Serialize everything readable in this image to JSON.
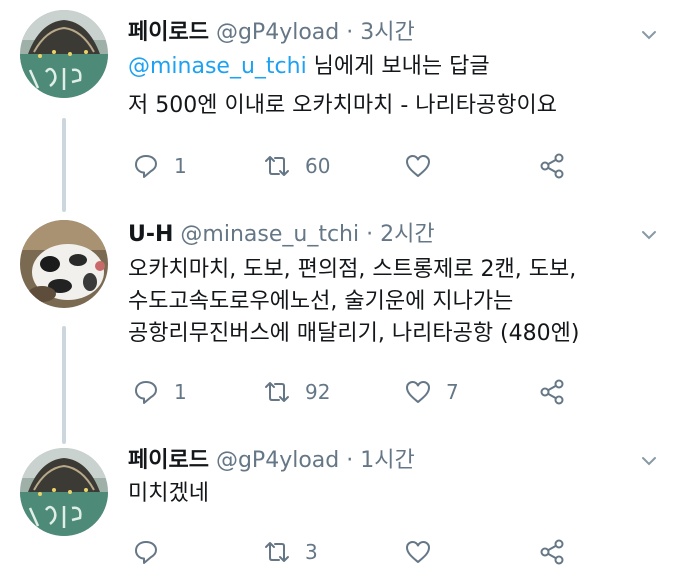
{
  "tweets": [
    {
      "name": "페이로드",
      "handle": "@gP4yload",
      "separator": "·",
      "time": "3시간",
      "reply_mention": "@minase_u_tchi",
      "reply_suffix": " 님에게 보내는 답글",
      "lines": [
        "저 500엔 이내로 오카치마치 - 나리타공항이요"
      ],
      "replies": "1",
      "retweets": "60",
      "likes": ""
    },
    {
      "name": "U-H",
      "handle": "@minase_u_tchi",
      "separator": "·",
      "time": "2시간",
      "lines": [
        "오카치마치, 도보, 편의점, 스트롱제로 2캔, 도보,",
        "수도고속도로우에노선, 술기운에 지나가는",
        "공항리무진버스에 매달리기, 나리타공항 (480엔)"
      ],
      "replies": "1",
      "retweets": "92",
      "likes": "7"
    },
    {
      "name": "페이로드",
      "handle": "@gP4yload",
      "separator": "·",
      "time": "1시간",
      "lines": [
        "미치겠네"
      ],
      "replies": "",
      "retweets": "3",
      "likes": ""
    }
  ],
  "icons": {
    "reply": "reply-icon",
    "retweet": "retweet-icon",
    "like": "heart-icon",
    "share": "share-icon",
    "menu": "chevron-down-icon"
  },
  "colors": {
    "text": "#14171a",
    "muted": "#657786",
    "link": "#1da1f2",
    "thread_line": "#ccd6dd"
  }
}
